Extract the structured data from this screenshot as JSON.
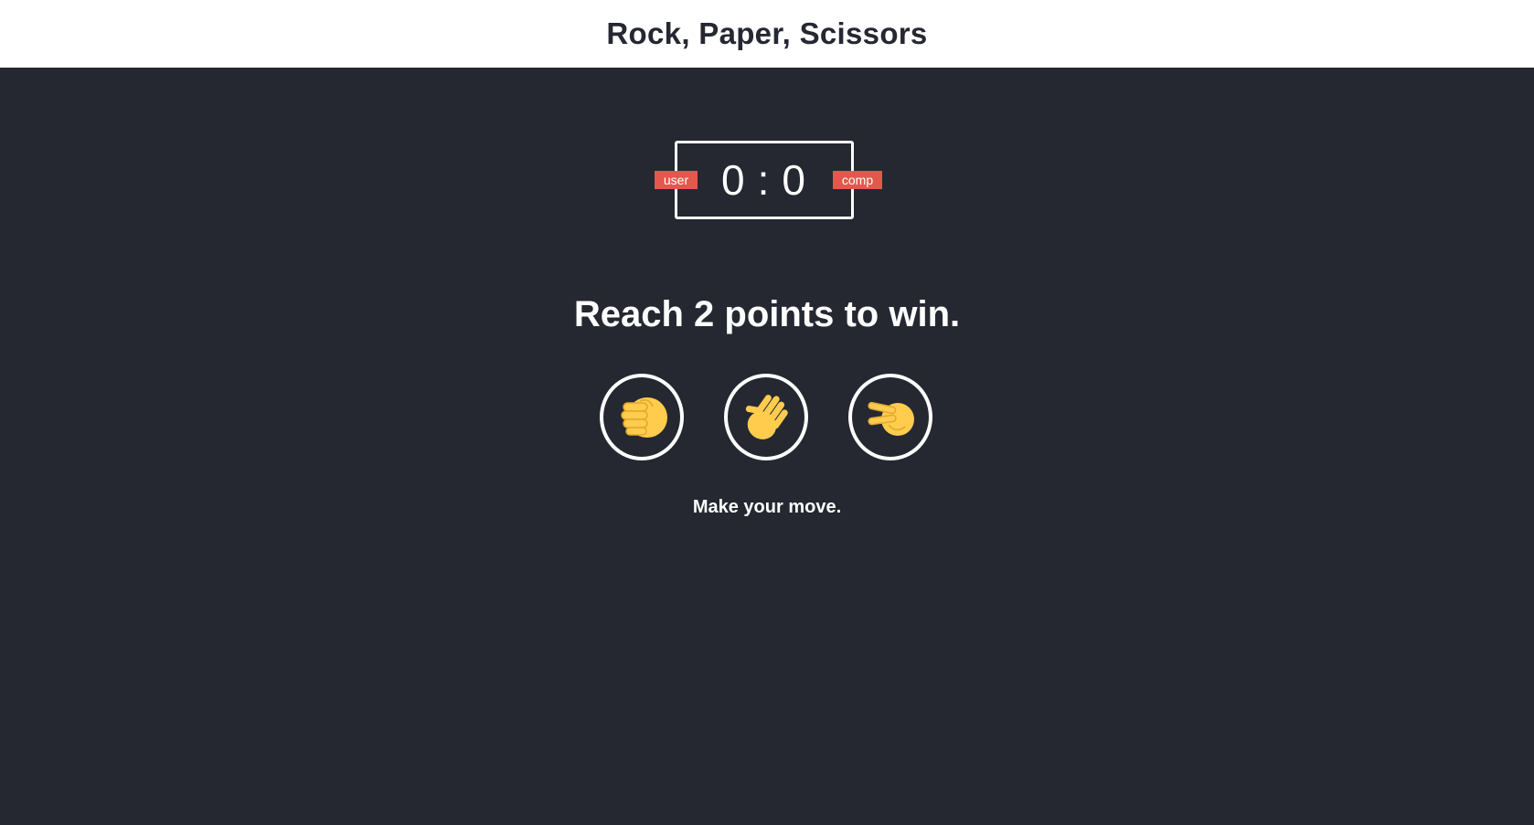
{
  "header": {
    "title": "Rock, Paper, Scissors"
  },
  "scoreboard": {
    "user_score": "0",
    "separator": ":",
    "comp_score": "0",
    "user_label": "user",
    "comp_label": "comp"
  },
  "goal_text": "Reach 2 points to win.",
  "choices": [
    {
      "id": "rock",
      "icon": "fist-icon"
    },
    {
      "id": "paper",
      "icon": "raised-hand-icon"
    },
    {
      "id": "scissors",
      "icon": "victory-hand-icon"
    }
  ],
  "message": "Make your move.",
  "colors": {
    "background": "#252831",
    "header_background": "#ffffff",
    "badge": "#e2584d",
    "emoji": "#ffcc4d"
  }
}
